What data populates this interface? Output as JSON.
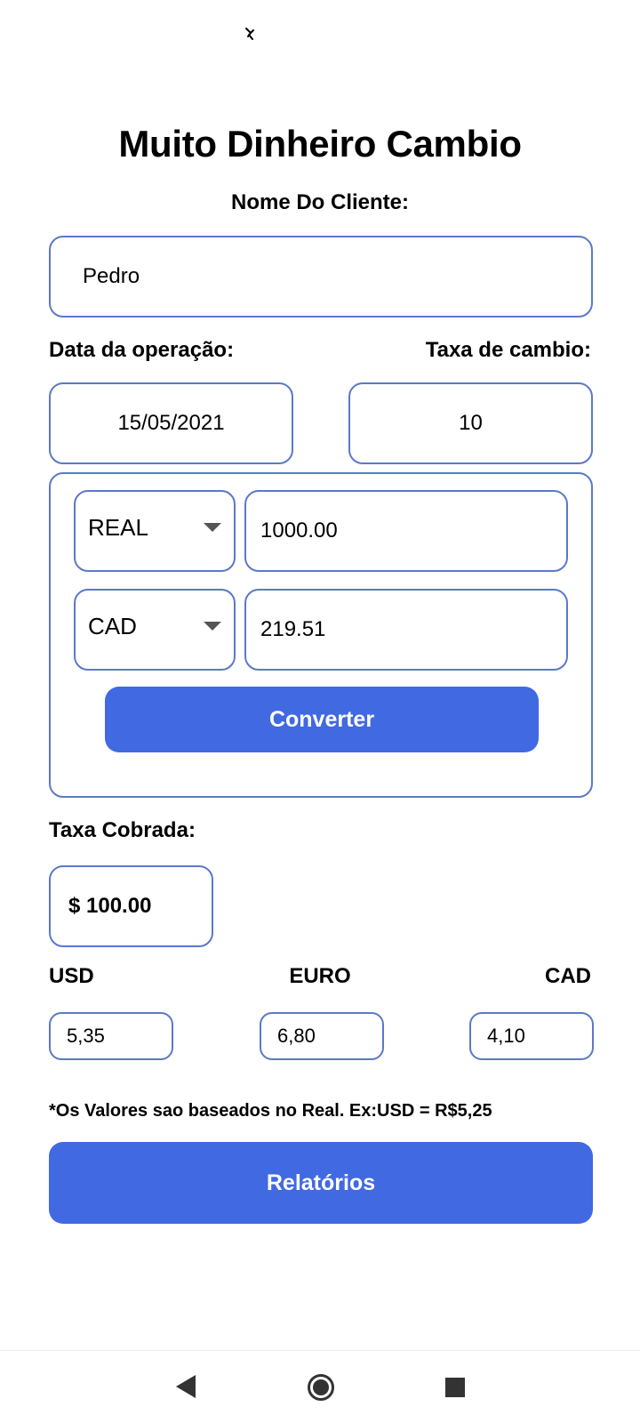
{
  "app": {
    "title": "Muito Dinheiro Cambio"
  },
  "client": {
    "label": "Nome Do Cliente:",
    "value": "Pedro"
  },
  "operation": {
    "date_label": "Data da operação:",
    "date_value": "15/05/2021",
    "rate_label": "Taxa de cambio:",
    "rate_value": "10"
  },
  "converter": {
    "from_currency": "REAL",
    "from_amount": "1000.00",
    "to_currency": "CAD",
    "to_amount": "219.51",
    "button_label": "Converter"
  },
  "fee": {
    "label": "Taxa Cobrada:",
    "value": "$ 100.00"
  },
  "rates": {
    "usd_label": "USD",
    "usd_value": "5,35",
    "euro_label": "EURO",
    "euro_value": "6,80",
    "cad_label": "CAD",
    "cad_value": "4,10"
  },
  "note": "*Os Valores sao baseados no Real. Ex:USD = R$5,25",
  "reports_button": "Relatórios",
  "colors": {
    "accent": "#4169e1",
    "border": "#5b79c9"
  },
  "icons": {
    "status": "mosquito-icon",
    "back": "back-triangle-icon",
    "home": "home-circle-icon",
    "recent": "recent-square-icon"
  }
}
